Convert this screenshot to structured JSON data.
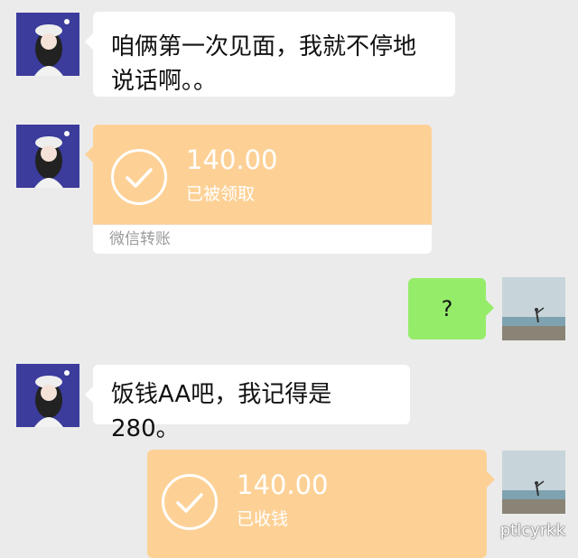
{
  "messages": [
    {
      "side": "left",
      "type": "text",
      "text": "咱俩第一次见面，我就不停地说话啊。。"
    },
    {
      "side": "left",
      "type": "transfer",
      "amount": "140.00",
      "status": "已被领取",
      "footer": "微信转账"
    },
    {
      "side": "right",
      "type": "text",
      "text": "?"
    },
    {
      "side": "left",
      "type": "text",
      "text": "饭钱AA吧，我记得是280。"
    },
    {
      "side": "right",
      "type": "transfer",
      "amount": "140.00",
      "status": "已收钱"
    }
  ],
  "watermark": "ptlcyrkk",
  "colors": {
    "background": "#ebebeb",
    "green_bubble": "#95ec69",
    "transfer_orange": "#fdd196",
    "white_bubble": "#ffffff"
  }
}
